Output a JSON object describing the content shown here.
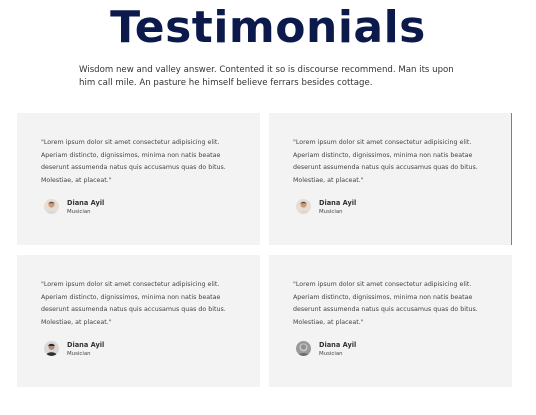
{
  "section": {
    "title": "Testimonials",
    "subtitle": "Wisdom new and valley answer. Contented it so is discourse recommend. Man its upon him call mile. An pasture he himself believe ferrars besides cottage."
  },
  "testimonials": [
    {
      "quote": "\"Lorem ipsum dolor sit amet consectetur adipisicing elit. Aperiam distincto, dignissimos, minima non natis beatae deserunt assumenda natus quis accusamus quas do bitus. Molestiae, at placeat.\"",
      "name": "Diana Ayil",
      "role": "Musician",
      "avatar": "woman-avatar"
    },
    {
      "quote": "\"Lorem ipsum dolor sit amet consectetur adipisicing elit. Aperiam distincto, dignissimos, minima non natis beatae deserunt assumenda natus quis accusamus quas do bitus. Molestiae, at placeat.\"",
      "name": "Diana Ayil",
      "role": "Musician",
      "avatar": "woman-avatar"
    },
    {
      "quote": "\"Lorem ipsum dolor sit amet consectetur adipisicing elit. Aperiam distincto, dignissimos, minima non natis beatae deserunt assumenda natus quis accusamus quas do bitus. Molestiae, at placeat.\"",
      "name": "Diana Ayil",
      "role": "Musician",
      "avatar": "man-avatar"
    },
    {
      "quote": "\"Lorem ipsum dolor sit amet consectetur adipisicing elit. Aperiam distincto, dignissimos, minima non natis beatae deserunt assumenda natus quis accusamus quas do bitus. Molestiae, at placeat.\"",
      "name": "Diana Ayil",
      "role": "Musician",
      "avatar": "person-avatar"
    }
  ],
  "colors": {
    "title": "#0c1a4b",
    "card_bg": "#f3f3f3",
    "accent": "#5b7de8"
  }
}
